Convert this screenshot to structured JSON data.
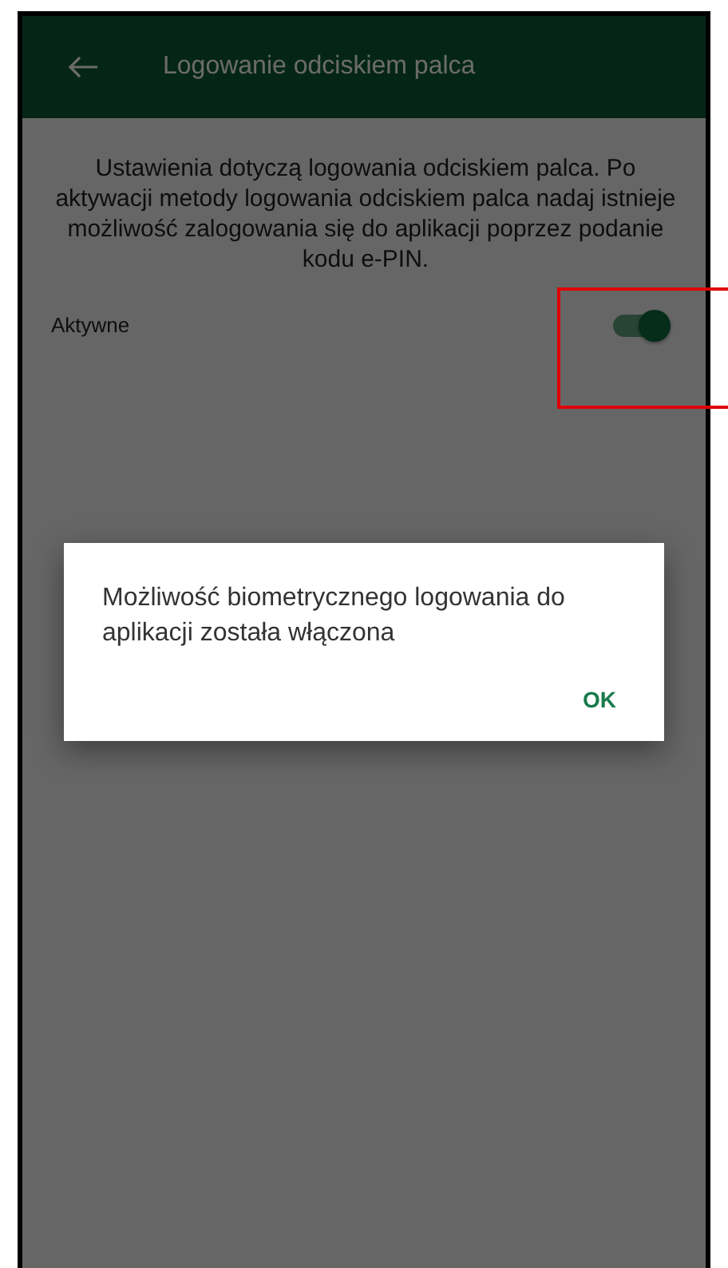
{
  "app_bar": {
    "title": "Logowanie odciskiem palca"
  },
  "description": "Ustawienia dotyczą logowania odciskiem palca. Po aktywacji metody logowania odciskiem palca nadaj istnieje możliwość zalogowania się do aplikacji poprzez podanie kodu e-PIN.",
  "settings": [
    {
      "label": "Aktywne",
      "on": true
    }
  ],
  "dialog": {
    "message": "Możliwość biometrycznego logowania do aplikacji została włączona",
    "buttons": [
      "OK"
    ]
  }
}
